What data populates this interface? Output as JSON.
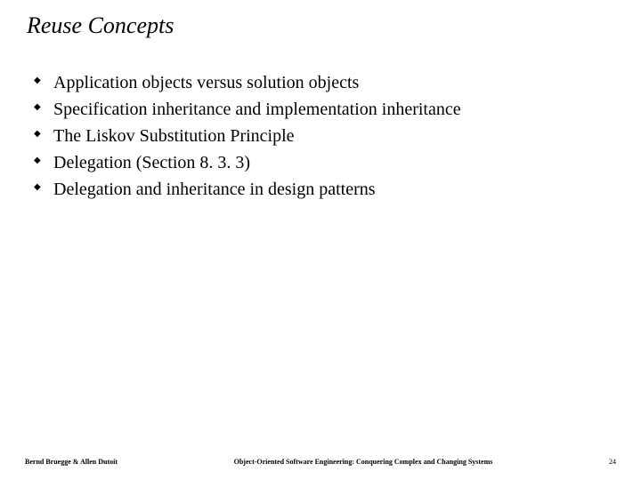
{
  "slide": {
    "title": "Reuse Concepts",
    "bullets": [
      "Application objects versus solution objects",
      "Specification inheritance and implementation inheritance",
      "The Liskov Substitution Principle",
      "Delegation (Section 8. 3. 3)",
      "Delegation and inheritance in design patterns"
    ]
  },
  "footer": {
    "left": "Bernd Bruegge & Allen Dutoit",
    "center": "Object-Oriented Software Engineering: Conquering Complex and Changing Systems",
    "right": "24"
  }
}
